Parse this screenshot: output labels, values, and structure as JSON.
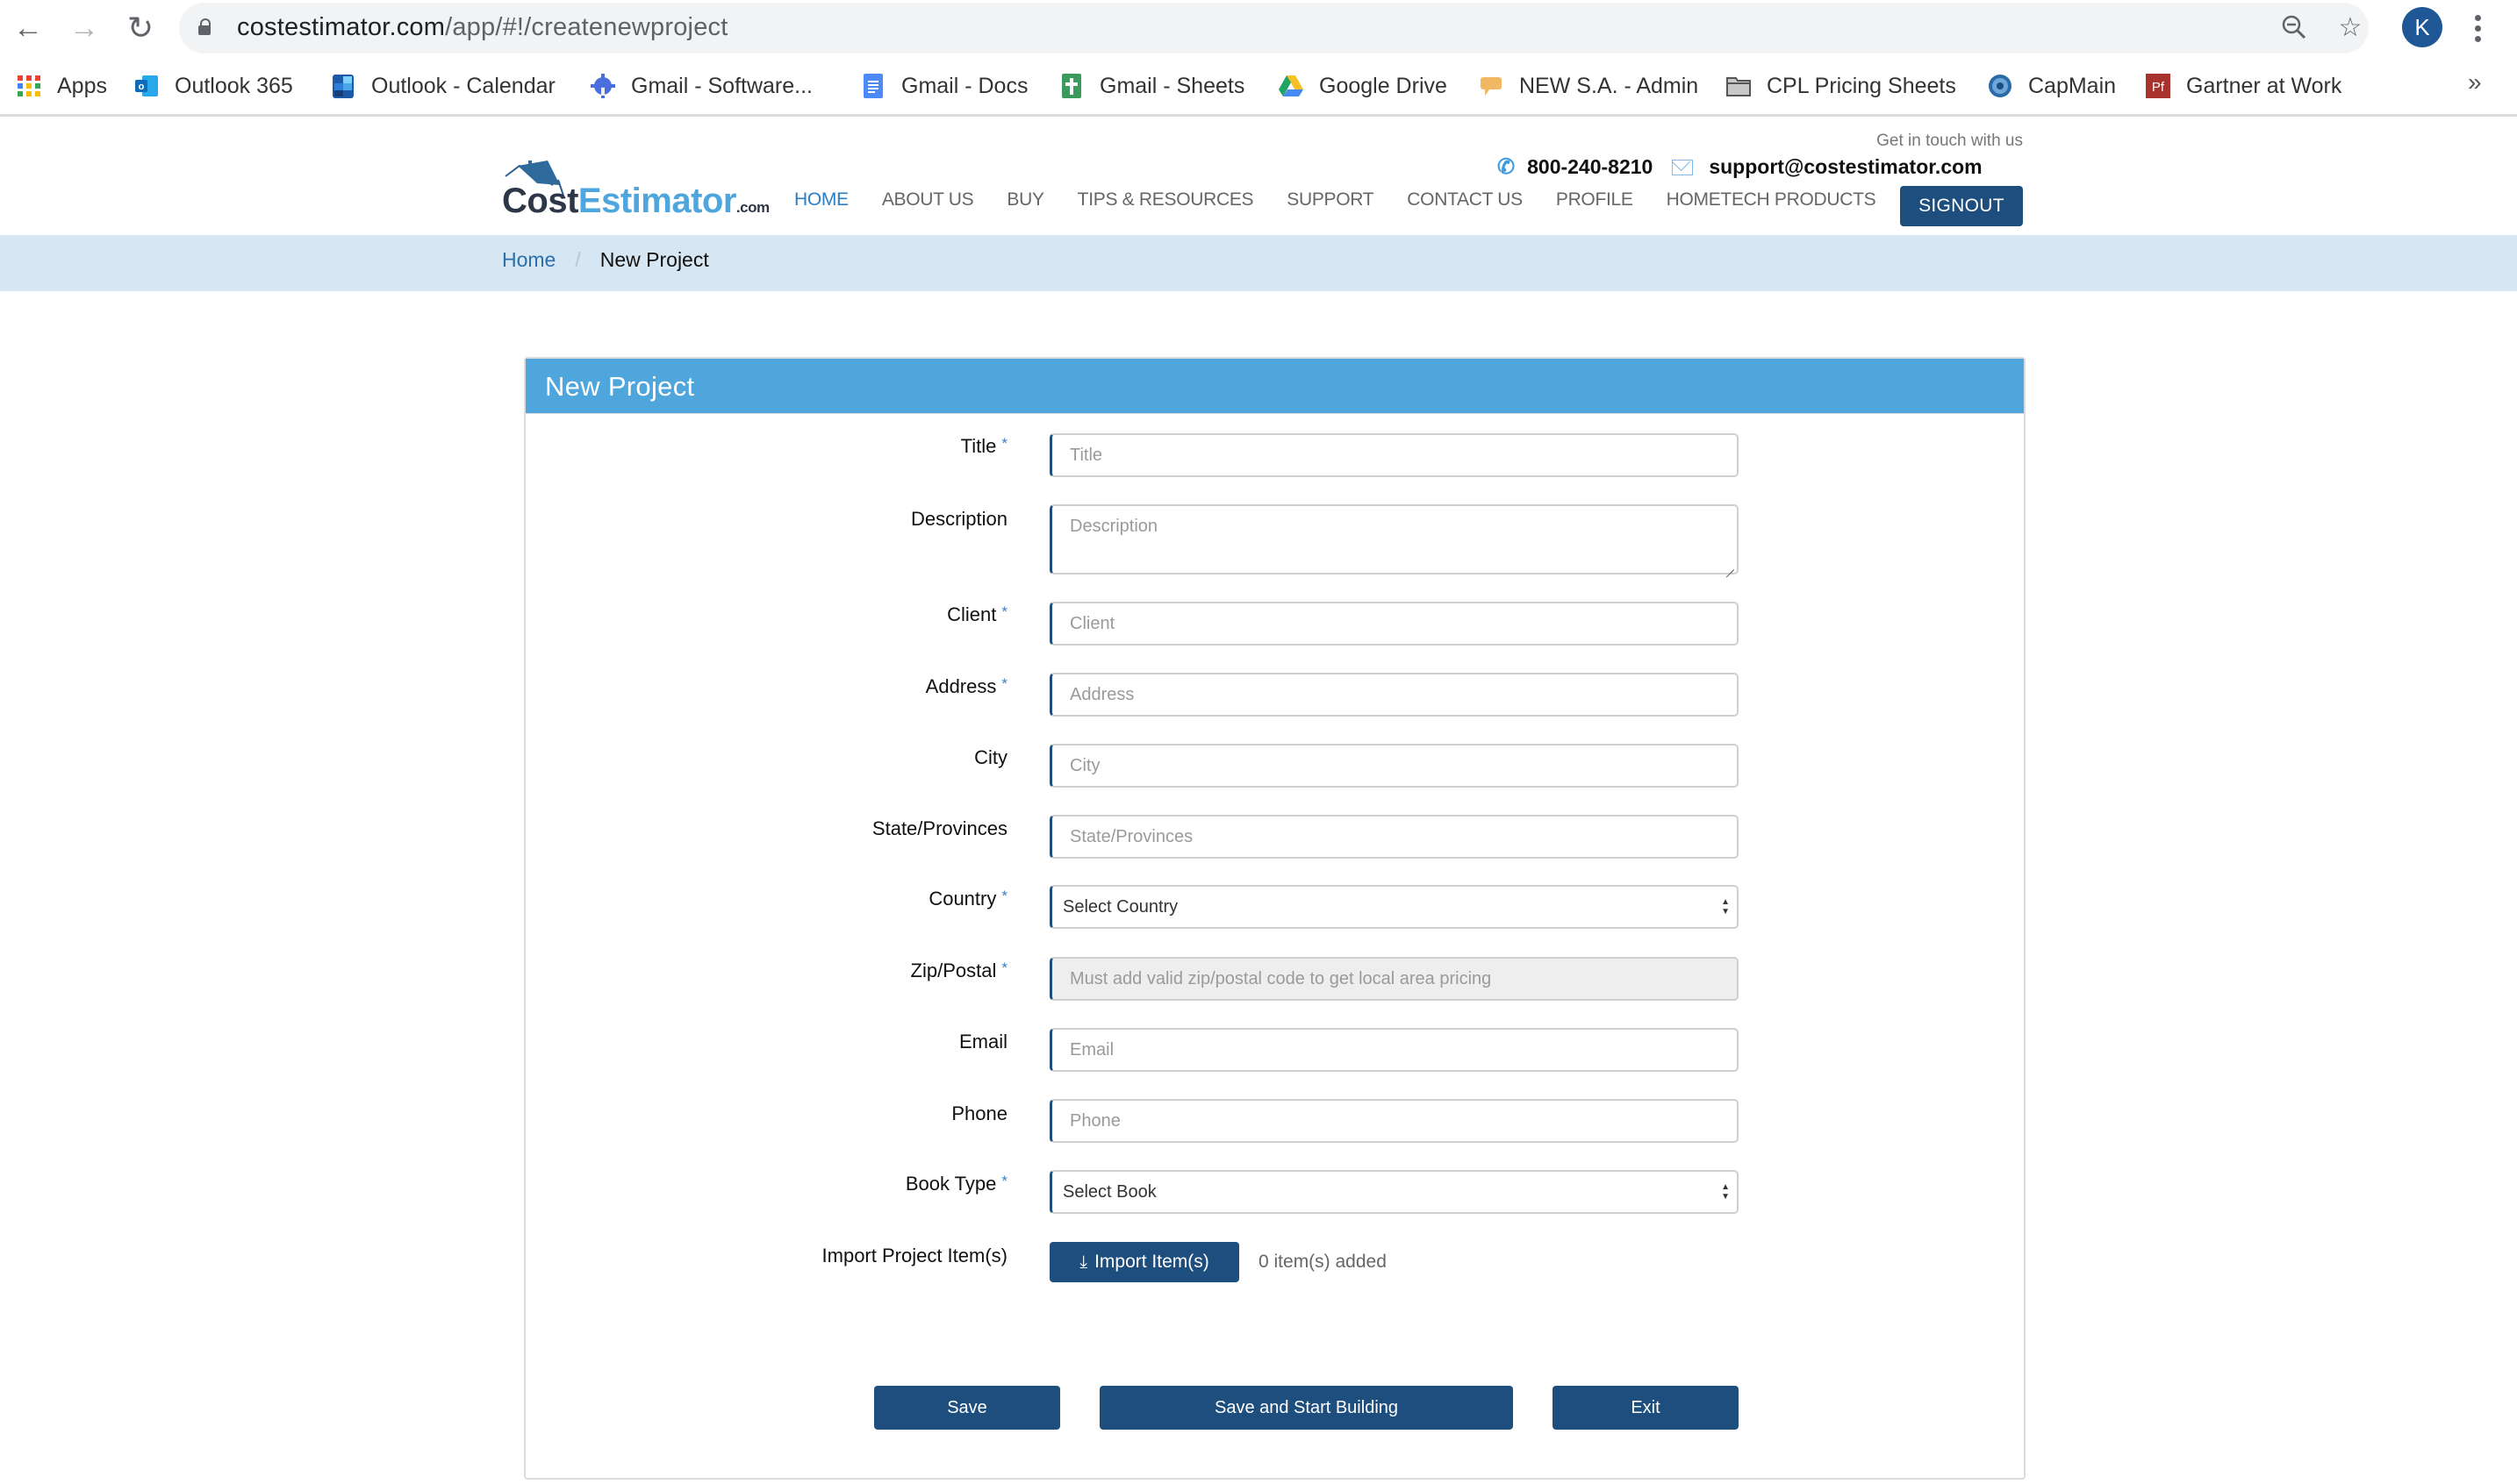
{
  "browser": {
    "url_host": "costestimator.com",
    "url_path": "/app/#!/createnewproject",
    "profile_initial": "K",
    "bookmarks": [
      {
        "label": "Apps",
        "icon": "apps-grid-icon"
      },
      {
        "label": "Outlook 365",
        "icon": "outlook-icon"
      },
      {
        "label": "Outlook - Calendar",
        "icon": "outlook-calendar-icon"
      },
      {
        "label": "Gmail - Software...",
        "icon": "gear-wrench-icon"
      },
      {
        "label": "Gmail - Docs",
        "icon": "google-docs-icon"
      },
      {
        "label": "Gmail - Sheets",
        "icon": "google-sheets-icon"
      },
      {
        "label": "Google Drive",
        "icon": "google-drive-icon"
      },
      {
        "label": "NEW S.A. - Admin",
        "icon": "chat-bubble-icon"
      },
      {
        "label": "CPL Pricing Sheets",
        "icon": "folder-icon"
      },
      {
        "label": "CapMain",
        "icon": "capmain-icon"
      },
      {
        "label": "Gartner at Work",
        "icon": "gartner-icon"
      }
    ],
    "more_bookmarks": "»"
  },
  "site": {
    "logo": {
      "part1": "Cost",
      "part2": "Estimator",
      "suffix": ".com"
    },
    "get_in_touch": "Get in touch with us",
    "phone": "800-240-8210",
    "email": "support@costestimator.com",
    "nav": [
      {
        "label": "HOME",
        "active": true
      },
      {
        "label": "ABOUT US"
      },
      {
        "label": "BUY"
      },
      {
        "label": "TIPS & RESOURCES"
      },
      {
        "label": "SUPPORT"
      },
      {
        "label": "CONTACT US"
      },
      {
        "label": "PROFILE"
      },
      {
        "label": "HOMETECH PRODUCTS"
      }
    ],
    "signout": "SIGNOUT",
    "colors": {
      "primary": "#1e4e7d",
      "panel_header": "#4ea6dc",
      "breadcrumb_bg": "#d6e6f2",
      "link": "#2b7fc4"
    }
  },
  "breadcrumb": {
    "home": "Home",
    "separator": "/",
    "current": "New Project"
  },
  "form": {
    "title": "New Project",
    "fields": [
      {
        "label": "Title",
        "required": true,
        "placeholder": "Title"
      },
      {
        "label": "Description",
        "required": false,
        "placeholder": "Description"
      },
      {
        "label": "Client",
        "required": true,
        "placeholder": "Client"
      },
      {
        "label": "Address",
        "required": true,
        "placeholder": "Address"
      },
      {
        "label": "City",
        "required": false,
        "placeholder": "City"
      },
      {
        "label": "State/Provinces",
        "required": false,
        "placeholder": "State/Provinces"
      },
      {
        "label": "Country",
        "required": true,
        "selected": "Select Country"
      },
      {
        "label": "Zip/Postal",
        "required": true,
        "placeholder": "Must add valid zip/postal code to get local area pricing"
      },
      {
        "label": "Email",
        "required": false,
        "placeholder": "Email"
      },
      {
        "label": "Phone",
        "required": false,
        "placeholder": "Phone"
      },
      {
        "label": "Book Type",
        "required": true,
        "selected": "Select Book"
      },
      {
        "label": "Import Project Item(s)",
        "required": false
      }
    ],
    "required_mark": "*",
    "import_button": "Import Item(s)",
    "items_added": "0 item(s) added",
    "buttons": {
      "save": "Save",
      "save_and_start": "Save and Start Building",
      "exit": "Exit"
    }
  }
}
